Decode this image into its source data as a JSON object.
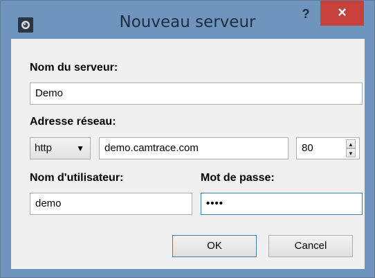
{
  "window": {
    "title": "Nouveau serveur",
    "help_label": "?",
    "close_label": "×"
  },
  "form": {
    "server_name": {
      "label": "Nom du serveur:",
      "value": "Demo"
    },
    "network": {
      "label": "Adresse réseau:",
      "protocol": "http",
      "host": "demo.camtrace.com",
      "port": "80"
    },
    "username": {
      "label": "Nom d'utilisateur:",
      "value": "demo"
    },
    "password": {
      "label": "Mot de passe:",
      "value": "••••"
    }
  },
  "buttons": {
    "ok": "OK",
    "cancel": "Cancel"
  },
  "icons": {
    "app": "app-icon",
    "combo_arrow": "chevron-down-icon",
    "spin_up": "chevron-up-icon",
    "spin_down": "chevron-down-icon"
  },
  "colors": {
    "titlebar": "#6f94bd",
    "close": "#c8403a",
    "focus_border": "#3c7fb1"
  }
}
